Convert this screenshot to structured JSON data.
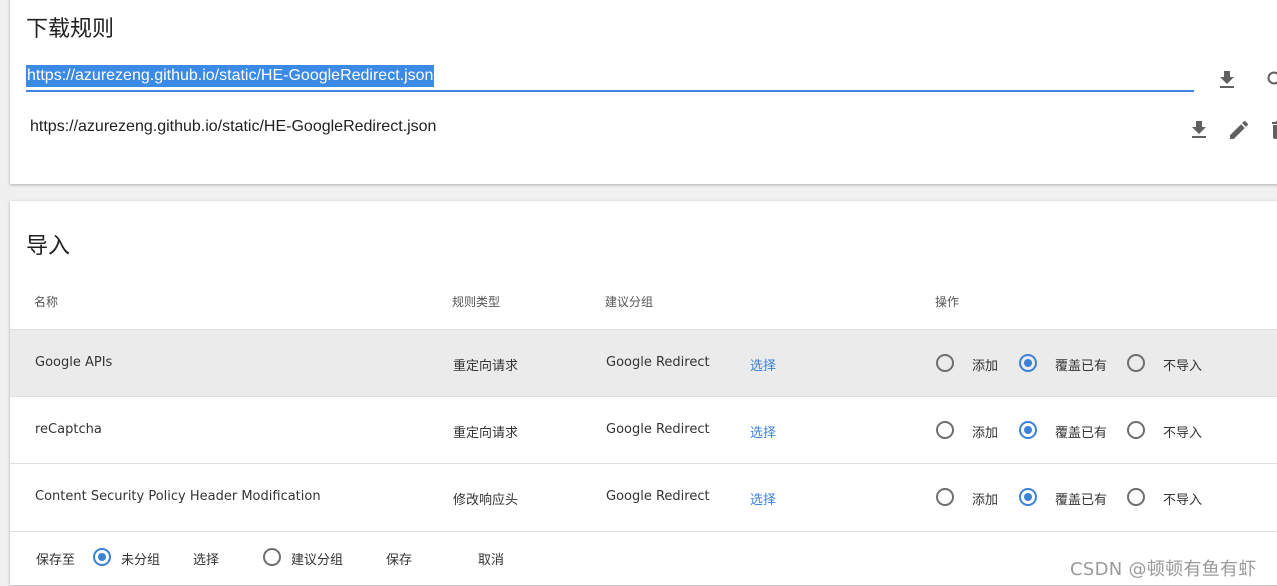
{
  "download_section": {
    "title": "下载规则",
    "url_input_value": "https://azurezeng.github.io/static/HE-GoogleRedirect.json",
    "rule_entries": [
      {
        "url": "https://azurezeng.github.io/static/HE-GoogleRedirect.json"
      }
    ]
  },
  "import_section": {
    "title": "导入",
    "columns": {
      "name": "名称",
      "type": "规则类型",
      "group": "建议分组",
      "action": "操作"
    },
    "rows": [
      {
        "name": "Google APIs",
        "type": "重定向请求",
        "group": "Google Redirect",
        "select_label": "选择",
        "selected_action": "overwrite"
      },
      {
        "name": "reCaptcha",
        "type": "重定向请求",
        "group": "Google Redirect",
        "select_label": "选择",
        "selected_action": "overwrite"
      },
      {
        "name": "Content Security Policy Header Modification",
        "type": "修改响应头",
        "group": "Google Redirect",
        "select_label": "选择",
        "selected_action": "overwrite"
      }
    ],
    "action_labels": {
      "add": "添加",
      "overwrite": "覆盖已有",
      "skip": "不导入"
    },
    "footer": {
      "save_to_label": "保存至",
      "ungrouped_label": "未分组",
      "select_label": "选择",
      "suggested_group_label": "建议分组",
      "save_label": "保存",
      "cancel_label": "取消",
      "selected_target": "ungrouped"
    }
  },
  "watermark": "CSDN @顿顿有鱼有虾",
  "colors": {
    "accent": "#3b82d6",
    "selection": "#3b8ae6",
    "row_highlight": "#ebebeb",
    "page_bg": "#f0f0f0"
  }
}
